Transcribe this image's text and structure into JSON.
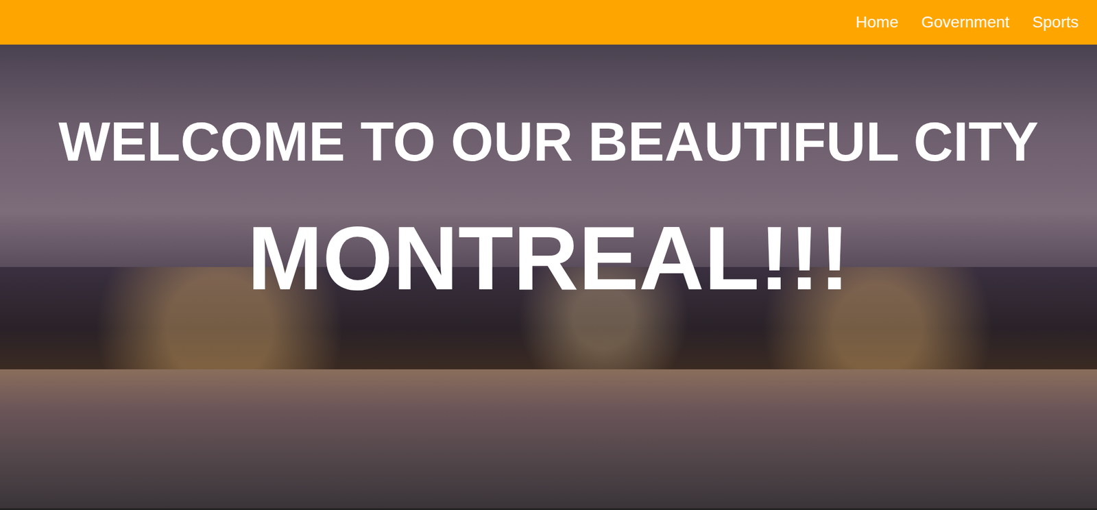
{
  "nav": {
    "items": [
      "Home",
      "Government",
      "Sports"
    ]
  },
  "hero": {
    "title": "WELCOME TO OUR BEAUTIFUL CITY",
    "subtitle": "MONTREAL!!!"
  }
}
